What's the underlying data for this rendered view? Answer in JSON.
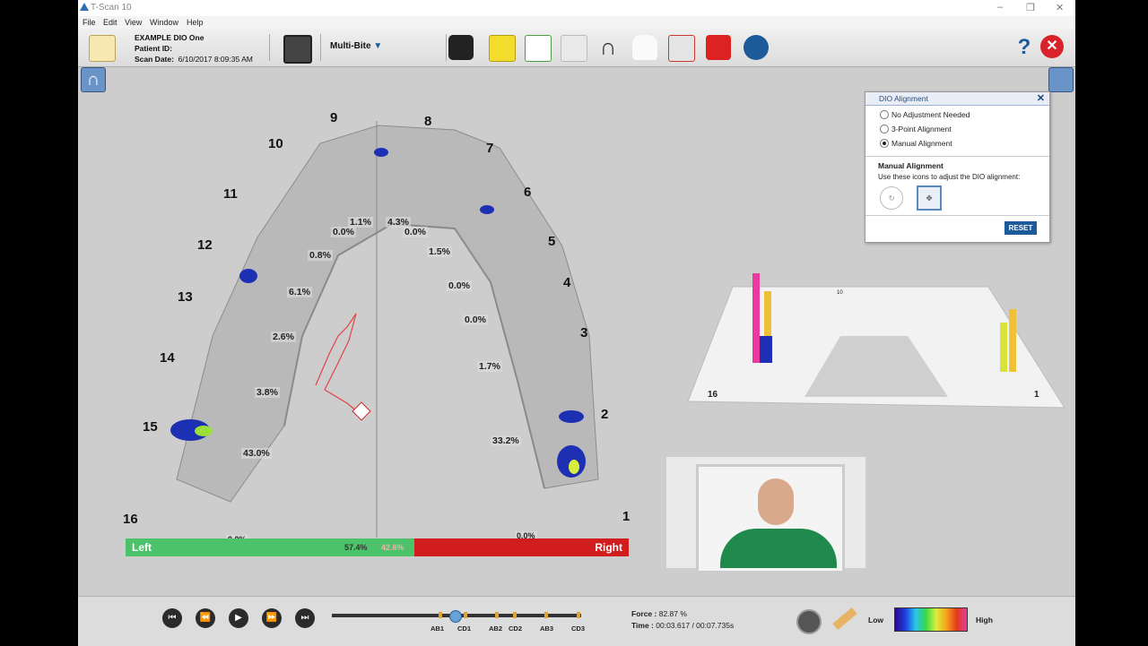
{
  "window": {
    "title": "T-Scan 10"
  },
  "menu": [
    "File",
    "Edit",
    "View",
    "Window",
    "Help"
  ],
  "patient": {
    "name": "EXAMPLE DIO One",
    "id_label": "Patient ID:",
    "scan_date_label": "Scan Date:",
    "scan_date": "6/10/2017 8:09:35 AM"
  },
  "toolbar": {
    "mode": "Multi-Bite"
  },
  "dio_panel": {
    "title": "DIO Alignment",
    "options": [
      "No Adjustment Needed",
      "3-Point Alignment",
      "Manual Alignment"
    ],
    "selected": 2,
    "section_title": "Manual Alignment",
    "instruction": "Use these icons to adjust the DIO alignment:",
    "reset_label": "RESET"
  },
  "arch": {
    "tooth_numbers": [
      {
        "n": "9"
      },
      {
        "n": "8"
      },
      {
        "n": "10"
      },
      {
        "n": "7"
      },
      {
        "n": "11"
      },
      {
        "n": "6"
      },
      {
        "n": "12"
      },
      {
        "n": "5"
      },
      {
        "n": "13"
      },
      {
        "n": "4"
      },
      {
        "n": "14"
      },
      {
        "n": "3"
      },
      {
        "n": "15"
      },
      {
        "n": "2"
      },
      {
        "n": "16"
      },
      {
        "n": "1"
      }
    ],
    "percentages": [
      "1.1%",
      "4.3%",
      "0.0%",
      "0.0%",
      "0.8%",
      "1.5%",
      "6.1%",
      "0.0%",
      "2.6%",
      "0.0%",
      "3.8%",
      "1.7%",
      "43.0%",
      "33.2%",
      "0.0%",
      "0.0%"
    ],
    "left_label": "Left",
    "left_value": "57.4%",
    "right_value": "42.6%",
    "right_label": "Right",
    "left_share": 57.4
  },
  "plot3d": {
    "left_label": "16",
    "right_label": "1",
    "top_label": "10"
  },
  "playback": {
    "bite_markers": [
      "AB1",
      "CD1",
      "AB2",
      "CD2",
      "AB3",
      "CD3"
    ],
    "force_label": "Force :",
    "force": "82.87 %",
    "time_label": "Time :",
    "time": "00:03.617 / 00:07.735s",
    "low_label": "Low",
    "high_label": "High"
  },
  "colors": {
    "left_bar": "#4cc26a",
    "right_bar": "#d11d1d",
    "accent": "#1c5a99"
  }
}
